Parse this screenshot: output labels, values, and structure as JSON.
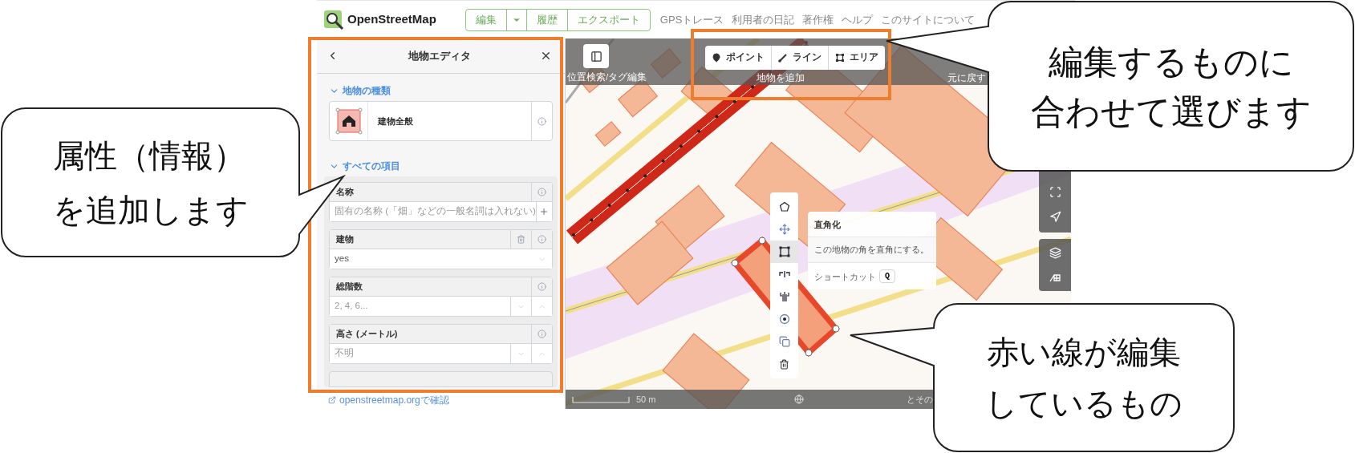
{
  "top_nav": {
    "logo_text": "OpenStreetMap",
    "edit_group": [
      {
        "kind": "button",
        "label": "編集"
      },
      {
        "kind": "dropdown"
      },
      {
        "kind": "button",
        "label": "履歴"
      },
      {
        "kind": "button",
        "label": "エクスポート"
      }
    ],
    "links": [
      "GPSトレース",
      "利用者の日記",
      "著作権",
      "ヘルプ",
      "このサイトについて"
    ]
  },
  "feature_editor": {
    "title": "地物エディタ",
    "preset_section": {
      "title": "地物の種類",
      "expanded": true,
      "preset": "建物全般"
    },
    "fields_section": {
      "title": "すべての項目",
      "expanded": true,
      "fields": [
        {
          "kind": "localized",
          "label": "名称",
          "placeholder": "固有の名称 (「畑」などの一般名詞は入れない)",
          "removable": false
        },
        {
          "kind": "combo",
          "label": "建物",
          "value": "yes",
          "removable": true
        },
        {
          "kind": "number",
          "label": "総階数",
          "placeholder": "2, 4, 6...",
          "removable": false
        },
        {
          "kind": "number",
          "label": "高さ (メートル)",
          "placeholder": "不明",
          "removable": false
        }
      ]
    },
    "view_link": "openstreetmap.orgで確認"
  },
  "map_toolbar": {
    "sidebar_label": "位置検索/タグ編集",
    "add_buttons": [
      {
        "kind": "point",
        "label": "ポイント"
      },
      {
        "kind": "line",
        "label": "ライン"
      },
      {
        "kind": "area",
        "label": "エリア"
      }
    ],
    "add_label": "地物を追加",
    "undo_label": "元に戻す"
  },
  "edit_menu": {
    "items": [
      {
        "kind": "circularize",
        "selected": false
      },
      {
        "kind": "move",
        "selected": false
      },
      {
        "kind": "orthogonalize",
        "selected": true
      },
      {
        "kind": "reflect_long",
        "selected": false
      },
      {
        "kind": "reflect_short",
        "selected": false
      },
      {
        "kind": "rotate",
        "selected": false
      },
      {
        "kind": "copy",
        "selected": false
      },
      {
        "kind": "delete",
        "selected": false
      }
    ],
    "tooltip": {
      "title": "直角化",
      "description": "この地物の角を直角にする。",
      "shortcut_label": "ショートカット",
      "shortcut_key": "Q"
    }
  },
  "map_footer": {
    "scale": "50 m",
    "attribution": "とその"
  },
  "callouts": [
    {
      "lines": [
        "属性（情報）",
        "を追加します"
      ]
    },
    {
      "lines": [
        "編集するものに",
        "合わせて選びます"
      ]
    },
    {
      "lines": [
        "赤い線が編集",
        "しているもの"
      ]
    }
  ]
}
